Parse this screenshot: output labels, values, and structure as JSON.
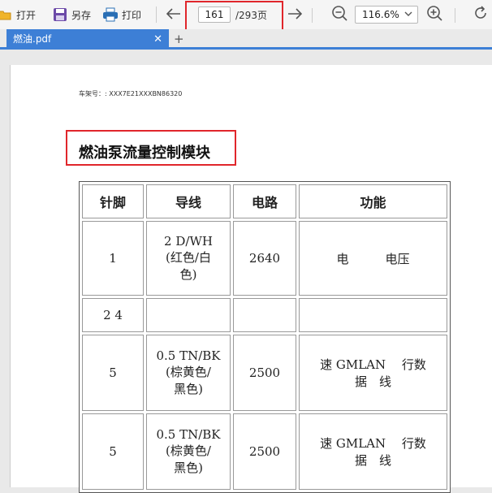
{
  "toolbar": {
    "open_label": "打开",
    "save_as_label": "另存",
    "print_label": "打印",
    "page_current": "161",
    "page_total": "/293页",
    "zoom": "116.6%"
  },
  "tabs": [
    {
      "label": "燃油.pdf"
    }
  ],
  "document": {
    "vin_line": "车架号：: XXX7E21XXXBN86320",
    "title": "燃油泵流量控制模块",
    "table": {
      "headers": [
        "针脚",
        "导线",
        "电路",
        "功能"
      ],
      "rows": [
        {
          "pin": "1",
          "wire_line1": "2 D/WH",
          "wire_line2": "(红色/白",
          "wire_line3": "色)",
          "circuit": "2640",
          "function_line1": "电　　　电压",
          "function_line2": ""
        },
        {
          "pin": "2 4",
          "wire_line1": "",
          "wire_line2": "",
          "wire_line3": "",
          "circuit": "",
          "function_line1": "",
          "function_line2": ""
        },
        {
          "pin": "5",
          "wire_line1": "0.5 TN/BK",
          "wire_line2": "(棕黄色/",
          "wire_line3": "黑色)",
          "circuit": "2500",
          "function_line1": "速 GMLAN　 行数",
          "function_line2": "据　线"
        },
        {
          "pin": "5",
          "wire_line1": "0.5 TN/BK",
          "wire_line2": "(棕黄色/",
          "wire_line3": "黑色)",
          "circuit": "2500",
          "function_line1": "速 GMLAN　 行数",
          "function_line2": "据　线"
        }
      ]
    }
  },
  "colors": {
    "accent_blue": "#3d7fd6",
    "highlight_red": "#e0262b"
  }
}
